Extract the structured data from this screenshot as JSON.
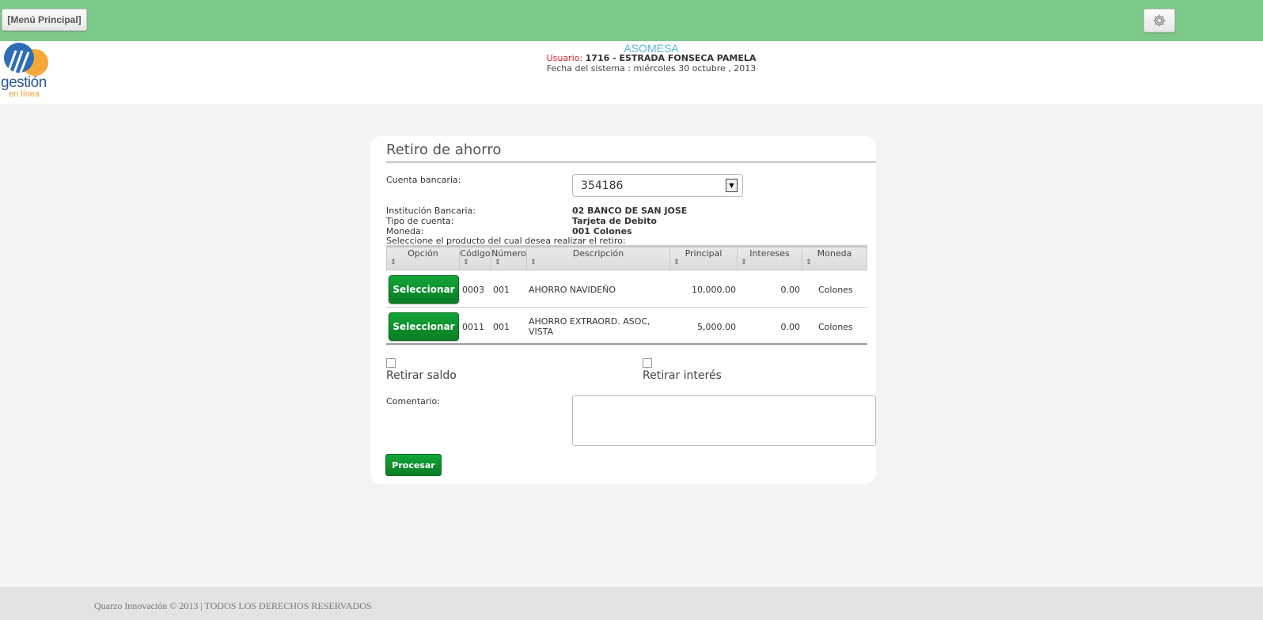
{
  "topbar": {
    "menu_label": "[Menú Principal]",
    "settings_icon": "gear-icon"
  },
  "header": {
    "logo_text": "gestión",
    "logo_subtext": "en línea",
    "company": "ASOMESA",
    "user_label": "Usuario:",
    "user_value": "1716 - ESTRADA FONSECA PAMELA",
    "date_text": "Fecha del sistema : miércoles 30 octubre , 2013"
  },
  "form": {
    "title": "Retiro de ahorro",
    "account_label": "Cuenta bancaria:",
    "account_value": "354186",
    "institution_label": "Institución Bancaria:",
    "institution_value": "02  BANCO DE SAN JOSE",
    "type_label": "Tipo de cuenta:",
    "type_value": "Tarjeta de Debito",
    "currency_label": "Moneda:",
    "currency_value": "001  Colones",
    "product_prompt": "Seleccione el producto del cual desea realizar el retiro:",
    "table": {
      "columns": [
        "Opción",
        "Código",
        "Número",
        "Descripción",
        "Principal",
        "Intereses",
        "Moneda"
      ],
      "rows": [
        {
          "button": "Seleccionar",
          "codigo": "0003",
          "numero": "001",
          "descripcion": "AHORRO NAVIDEÑO",
          "principal": "10,000.00",
          "intereses": "0.00",
          "moneda": "Colones"
        },
        {
          "button": "Seleccionar",
          "codigo": "0011",
          "numero": "001",
          "descripcion": "AHORRO EXTRAORD. ASOC, VISTA",
          "principal": "5,000.00",
          "intereses": "0.00",
          "moneda": "Colones"
        }
      ]
    },
    "withdraw_balance_label": "Retirar saldo",
    "withdraw_interest_label": "Retirar interés",
    "comment_label": "Comentario:",
    "comment_value": "",
    "process_label": "Procesar"
  },
  "footer": {
    "text": "Quarzo Innovación © 2013 | TODOS LOS DERECHOS RESERVADOS"
  }
}
